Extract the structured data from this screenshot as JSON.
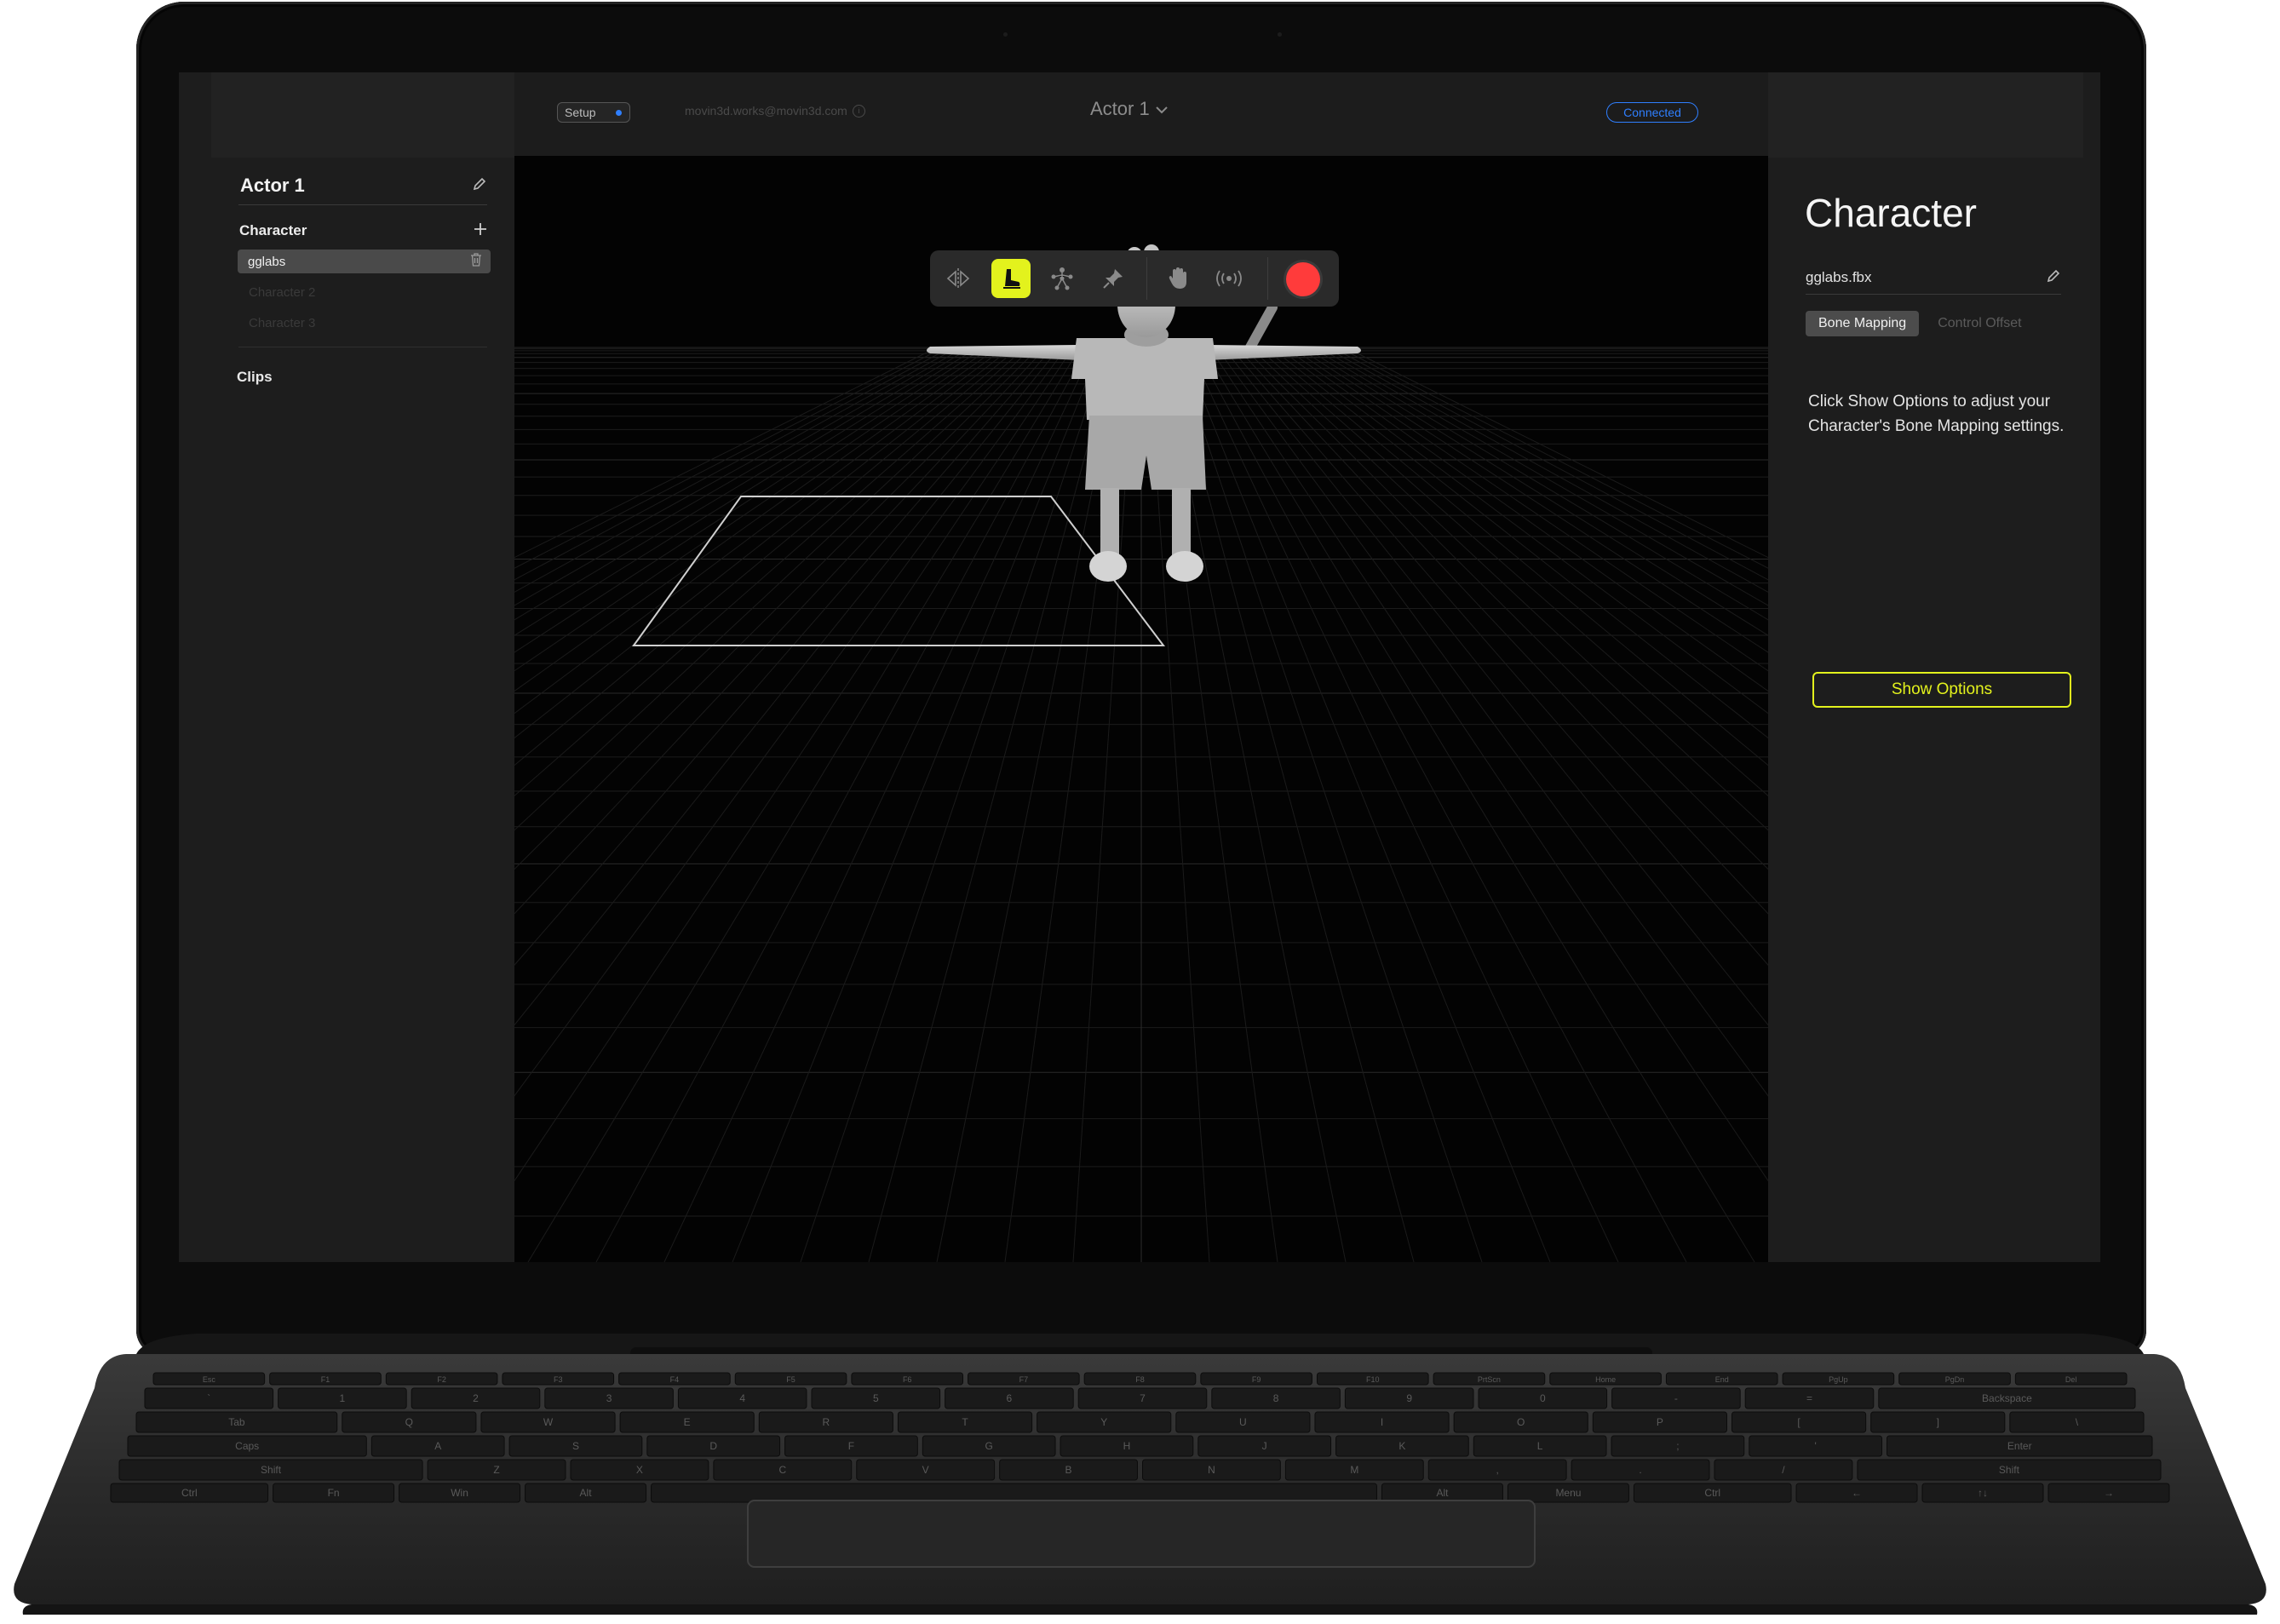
{
  "app": {
    "left_panel": {
      "actor_title": "Actor 1",
      "character_heading": "Character",
      "characters": [
        "gglabs",
        "Character 2",
        "Character 3"
      ],
      "clips_heading": "Clips"
    },
    "top_bar": {
      "setup_label": "Setup",
      "account_email": "movin3d.works@movin3d.com",
      "actor_selector": "Actor 1",
      "connection_status": "Connected"
    },
    "toolbar": {
      "tools": [
        "mirror-icon",
        "foot-icon",
        "skeleton-icon",
        "pin-icon",
        "hand-icon",
        "broadcast-icon",
        "record-icon"
      ],
      "active_tool": "foot-icon"
    },
    "right_panel": {
      "title": "Character",
      "file_name": "gglabs.fbx",
      "tabs": [
        "Bone Mapping",
        "Control Offset"
      ],
      "active_tab": "Bone Mapping",
      "message": "Click Show Options to adjust your Character's Bone Mapping settings.",
      "show_options_label": "Show Options"
    }
  },
  "colors": {
    "accent": "#e3f21d",
    "status_blue": "#2f7fff",
    "record_red": "#ff3b3b",
    "panel": "#1d1d1d"
  },
  "keyboard": {
    "row_function": [
      "Esc",
      "F1",
      "F2",
      "F3",
      "F4",
      "F5",
      "F6",
      "F7",
      "F8",
      "F9",
      "F10",
      "PrtScn",
      "Home",
      "End",
      "PgUp",
      "PgDn",
      "Del"
    ],
    "row_number": [
      "`",
      "1",
      "2",
      "3",
      "4",
      "5",
      "6",
      "7",
      "8",
      "9",
      "0",
      "-",
      "=",
      "Backspace"
    ],
    "row_q": [
      "Tab",
      "Q",
      "W",
      "E",
      "R",
      "T",
      "Y",
      "U",
      "I",
      "O",
      "P",
      "[",
      "]",
      "\\"
    ],
    "row_a": [
      "Caps",
      "A",
      "S",
      "D",
      "F",
      "G",
      "H",
      "J",
      "K",
      "L",
      ";",
      "'",
      "Enter"
    ],
    "row_z": [
      "Shift",
      "Z",
      "X",
      "C",
      "V",
      "B",
      "N",
      "M",
      ",",
      ".",
      "/",
      "Shift"
    ],
    "row_space": [
      "Ctrl",
      "Fn",
      "Win",
      "Alt",
      "",
      "Alt",
      "Menu",
      "Ctrl",
      "←",
      "↑↓",
      "→"
    ]
  }
}
